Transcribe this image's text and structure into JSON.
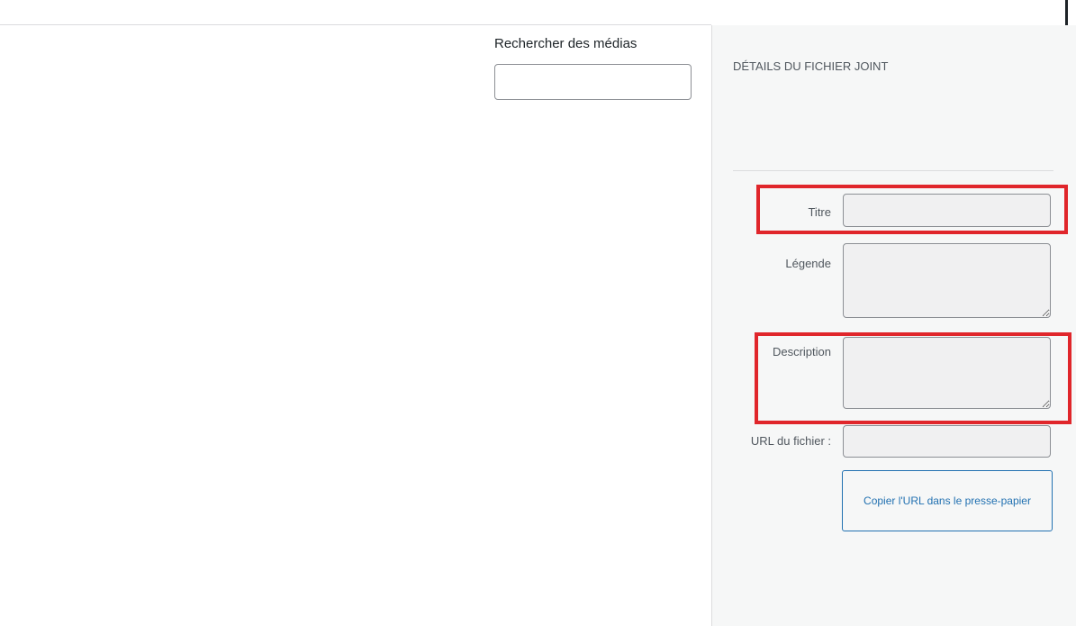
{
  "search": {
    "label": "Rechercher des médias",
    "value": ""
  },
  "attachment_details": {
    "title": "DÉTAILS DU FICHIER JOINT",
    "fields": {
      "title_label": "Titre",
      "caption_label": "Légende",
      "description_label": "Description",
      "url_label": "URL du fichier :"
    },
    "copy_url_button": "Copier l'URL dans le presse-papier"
  },
  "colors": {
    "highlight": "#e0262b",
    "button_accent": "#2271b1",
    "sidebar_bg": "#f6f7f7"
  }
}
